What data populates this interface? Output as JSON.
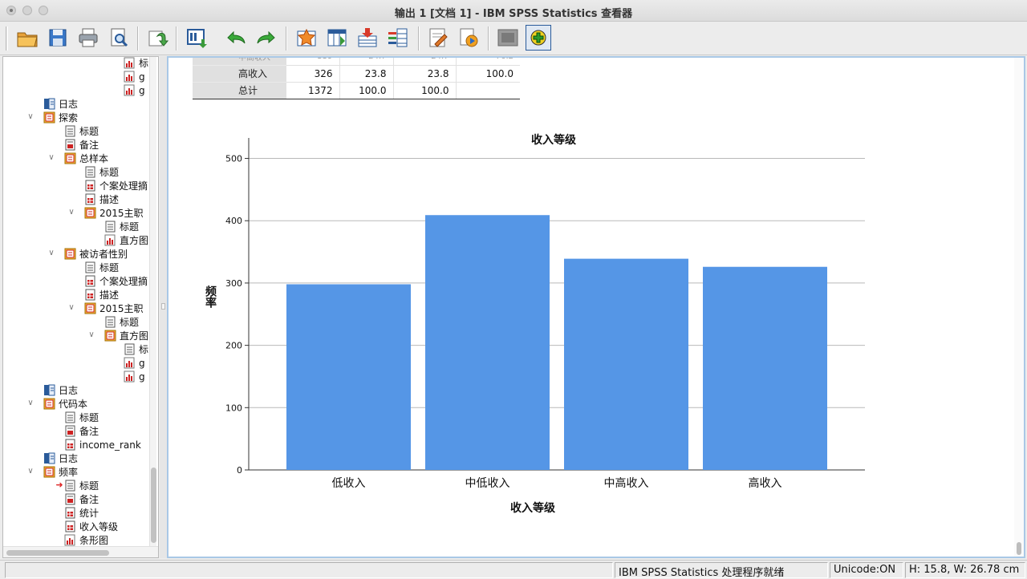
{
  "window": {
    "title": "输出 1 [文档 1] - IBM SPSS Statistics 查看器"
  },
  "toolbar": {
    "buttons": [
      "open-icon",
      "save-icon",
      "print-icon",
      "print-preview-icon",
      "export-icon",
      "recall-dialog-icon",
      "undo-icon",
      "redo-icon",
      "goto-case-icon",
      "goto-variable-icon",
      "insert-cases-icon",
      "variables-icon",
      "chart-editor-icon",
      "designate-window-icon",
      "select-cases-icon",
      "show-all-icon"
    ]
  },
  "tree": {
    "items": [
      {
        "label": "标"
      },
      {
        "label": "g"
      },
      {
        "label": "g"
      },
      {
        "label": "日志"
      },
      {
        "label": "探索"
      },
      {
        "label": "标题"
      },
      {
        "label": "备注"
      },
      {
        "label": "总样本"
      },
      {
        "label": "标题"
      },
      {
        "label": "个案处理摘"
      },
      {
        "label": "描述"
      },
      {
        "label": "2015主职"
      },
      {
        "label": "标题"
      },
      {
        "label": "直方图"
      },
      {
        "label": "被访者性别"
      },
      {
        "label": "标题"
      },
      {
        "label": "个案处理摘"
      },
      {
        "label": "描述"
      },
      {
        "label": "2015主职"
      },
      {
        "label": "标题"
      },
      {
        "label": "直方图"
      },
      {
        "label": "标"
      },
      {
        "label": "g"
      },
      {
        "label": "g"
      },
      {
        "label": "日志"
      },
      {
        "label": "代码本"
      },
      {
        "label": "标题"
      },
      {
        "label": "备注"
      },
      {
        "label": "income_rank"
      },
      {
        "label": "日志"
      },
      {
        "label": "频率"
      },
      {
        "label": "标题"
      },
      {
        "label": "备注"
      },
      {
        "label": "统计"
      },
      {
        "label": "收入等级"
      },
      {
        "label": "条形图"
      }
    ]
  },
  "table": {
    "rows": [
      {
        "label": "高收入",
        "freq": "326",
        "pct": "23.8",
        "valid": "23.8",
        "cum": "100.0"
      },
      {
        "label": "总计",
        "freq": "1372",
        "pct": "100.0",
        "valid": "100.0",
        "cum": ""
      }
    ]
  },
  "chart_data": {
    "type": "bar",
    "title": "收入等级",
    "xlabel": "收入等级",
    "ylabel": "频率",
    "categories": [
      "低收入",
      "中低收入",
      "中高收入",
      "高收入"
    ],
    "values": [
      298,
      409,
      339,
      326
    ],
    "ylim": [
      0,
      520
    ],
    "yticks": [
      0,
      100,
      200,
      300,
      400,
      500
    ],
    "bar_color": "#5596e6",
    "grid": true
  },
  "status": {
    "processor": "IBM SPSS Statistics 处理程序就绪",
    "unicode": "Unicode:ON",
    "dims": "H: 15.8, W: 26.78 cm"
  }
}
